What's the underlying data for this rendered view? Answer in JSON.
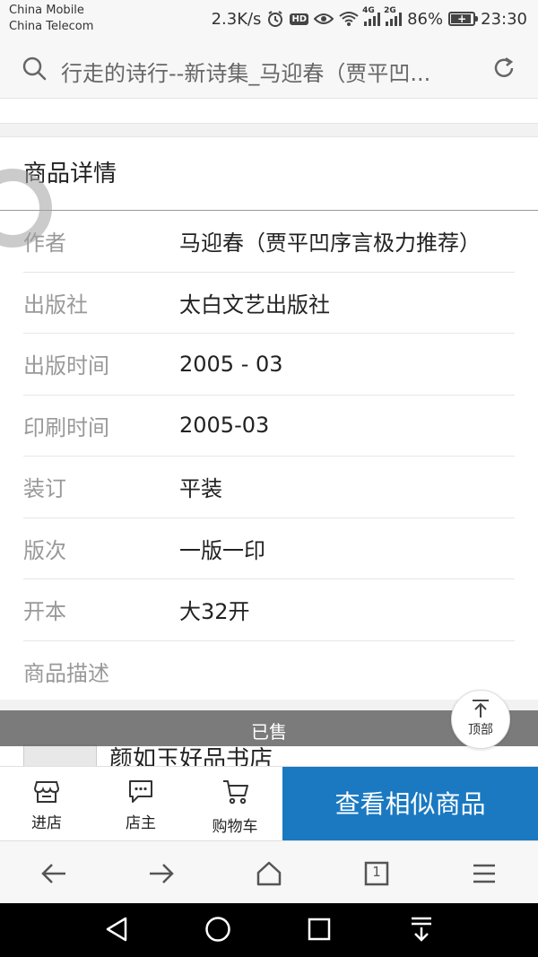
{
  "status_bar": {
    "carrier_1": "China Mobile",
    "carrier_2": "China Telecom",
    "speed": "2.3K/s",
    "hd": "HD",
    "net_1": "4G",
    "net_2": "2G",
    "battery": "86%",
    "time": "23:30"
  },
  "search": {
    "text": "行走的诗行--新诗集_马迎春（贾平凹..."
  },
  "details": {
    "title": "商品详情",
    "rows": [
      {
        "label": "作者",
        "value": "马迎春（贾平凹序言极力推荐）"
      },
      {
        "label": "出版社",
        "value": "太白文艺出版社"
      },
      {
        "label": "出版时间",
        "value": "2005 - 03"
      },
      {
        "label": "印刷时间",
        "value": "2005-03"
      },
      {
        "label": "装订",
        "value": "平装"
      },
      {
        "label": "版次",
        "value": "一版一印"
      },
      {
        "label": "开本",
        "value": "大32开"
      },
      {
        "label": "商品描述",
        "value": ""
      }
    ]
  },
  "shop": {
    "sold_label": "已售",
    "name": "颜如玉好品书店"
  },
  "top_button": {
    "label": "顶部"
  },
  "action_bar": {
    "enter_store": "进店",
    "owner": "店主",
    "cart": "购物车",
    "cta": "查看相似商品"
  },
  "browser_nav": {
    "tab_count": "1"
  },
  "colors": {
    "accent": "#1a79c1"
  }
}
